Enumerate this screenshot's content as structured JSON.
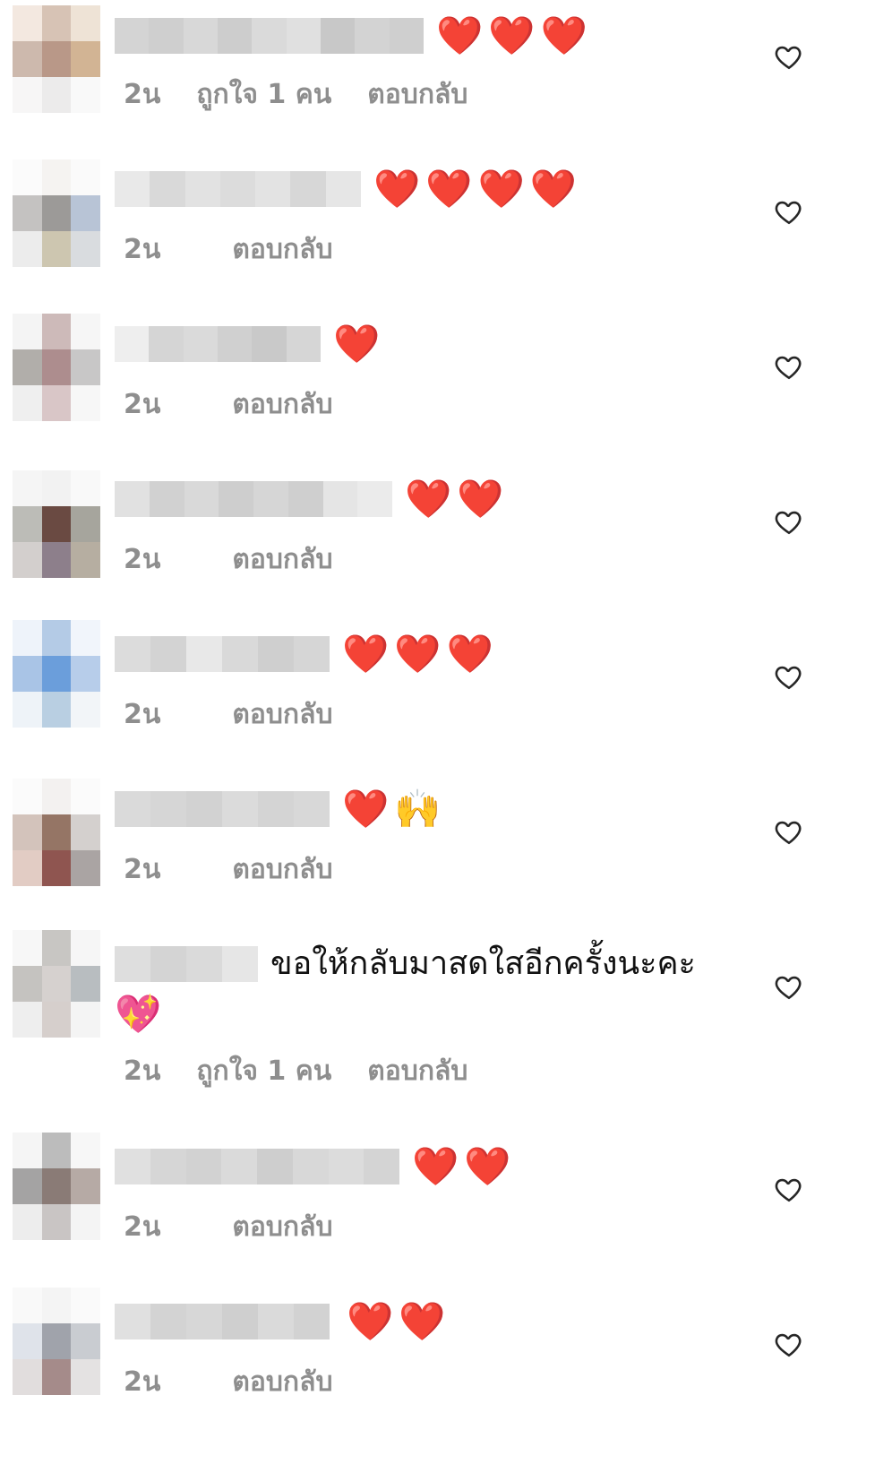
{
  "comments": [
    {
      "text": "",
      "emoji": "❤️❤️❤️",
      "time": "2น",
      "likes": "ถูกใจ 1 คน",
      "reply": "ตอบกลับ"
    },
    {
      "text": "",
      "emoji": "❤️❤️❤️❤️",
      "time": "2น",
      "likes": "",
      "reply": "ตอบกลับ"
    },
    {
      "text": "",
      "emoji": "❤️",
      "time": "2น",
      "likes": "",
      "reply": "ตอบกลับ"
    },
    {
      "text": "",
      "emoji": "❤️❤️",
      "time": "2น",
      "likes": "",
      "reply": "ตอบกลับ"
    },
    {
      "text": "",
      "emoji": "❤️❤️❤️",
      "time": "2น",
      "likes": "",
      "reply": "ตอบกลับ"
    },
    {
      "text": "",
      "emoji": "❤️🙌",
      "time": "2น",
      "likes": "",
      "reply": "ตอบกลับ"
    },
    {
      "text": "ขอให้กลับมาสดใสอีกครั้งนะคะ",
      "emoji": "💖",
      "time": "2น",
      "likes": "ถูกใจ 1 คน",
      "reply": "ตอบกลับ"
    },
    {
      "text": "",
      "emoji": "❤️❤️",
      "time": "2น",
      "likes": "",
      "reply": "ตอบกลับ"
    },
    {
      "text": "",
      "emoji": "❤️❤️",
      "time": "2น",
      "likes": "",
      "reply": "ตอบกลับ"
    }
  ],
  "icons": {
    "like": "heart-outline-icon"
  },
  "colors": {
    "meta": "#8e8e8e",
    "heart": "#e3202d"
  }
}
